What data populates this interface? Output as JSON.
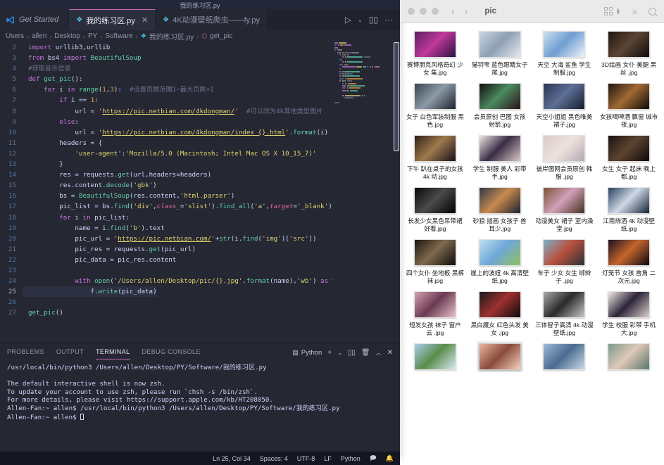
{
  "window": {
    "title": "我的练习区.py"
  },
  "editor_tabs": {
    "get_started": "Get Started",
    "tabs": [
      {
        "label": "我的练习区.py",
        "active": true,
        "close": "✕"
      },
      {
        "label": "4K动漫壁纸爬虫——fy.py",
        "active": false,
        "close": ""
      }
    ],
    "actions": [
      "run-icon",
      "chevron-down-icon",
      "split-editor-icon",
      "more-actions-icon"
    ]
  },
  "breadcrumb": {
    "items": [
      "Users",
      "allen",
      "Desktop",
      "PY",
      "Software",
      "我的练习区.py",
      "get_pic"
    ],
    "separator": "›"
  },
  "code": {
    "lines": [
      {
        "n": "2",
        "text": "import urllib3,urllib"
      },
      {
        "n": "3",
        "text": "from bs4 import BeautifulSoup"
      },
      {
        "n": "4",
        "text": "#获取音乐信息"
      },
      {
        "n": "5",
        "text": "def get_pic():"
      },
      {
        "n": "6",
        "text": "    for i in range(1,3):  #设置页数范围1~最大页数+1"
      },
      {
        "n": "7",
        "text": "        if i == 1:"
      },
      {
        "n": "8",
        "text": "            url = 'https://pic.netbian.com/4kdongman/'  #可以改为4k其他类型图片"
      },
      {
        "n": "9",
        "text": "        else:"
      },
      {
        "n": "10",
        "text": "            url = 'https://pic.netbian.com/4kdongman/index_{}.html'.format(i)"
      },
      {
        "n": "11",
        "text": "        headers = {"
      },
      {
        "n": "12",
        "text": "            'user-agent':'Mozilla/5.0 (Macintosh; Intel Mac OS X 10_15_7)'"
      },
      {
        "n": "13",
        "text": "        }"
      },
      {
        "n": "14",
        "text": "        res = requests.get(url,headers=headers)"
      },
      {
        "n": "15",
        "text": "        res.content.decode('gbk')"
      },
      {
        "n": "16",
        "text": "        bs = BeautifulSoup(res.content,'html.parser')"
      },
      {
        "n": "17",
        "text": "        pic_list = bs.find('div',class_='slist').find_all('a',target='_blank')"
      },
      {
        "n": "18",
        "text": "        for i in pic_list:"
      },
      {
        "n": "19",
        "text": "            name = i.find('b').text"
      },
      {
        "n": "20",
        "text": "            pic_url = 'https://pic.netbian.com/'+str(i.find('img')['src'])"
      },
      {
        "n": "21",
        "text": "            pic_res = requests.get(pic_url)"
      },
      {
        "n": "22",
        "text": "            pic_data = pic_res.content"
      },
      {
        "n": "23",
        "text": ""
      },
      {
        "n": "24",
        "text": "            with open('/Users/allen/Desktop/pic/{}.jpg'.format(name),'wb') as f:"
      },
      {
        "n": "25",
        "text": "                f.write(pic_data)"
      },
      {
        "n": "26",
        "text": ""
      },
      {
        "n": "27",
        "text": "get_pic()"
      }
    ],
    "cursor_line": "25"
  },
  "panel": {
    "tabs": [
      {
        "label": "PROBLEMS",
        "active": false
      },
      {
        "label": "OUTPUT",
        "active": false
      },
      {
        "label": "TERMINAL",
        "active": true
      },
      {
        "label": "DEBUG CONSOLE",
        "active": false
      }
    ],
    "shell": "Python",
    "actions": [
      "add-terminal-icon",
      "chevron-down-icon",
      "split-terminal-icon",
      "kill-terminal-icon",
      "maximize-panel-icon",
      "close-panel-icon"
    ],
    "terminal_lines": [
      "/usr/local/bin/python3 /Users/allen/Desktop/PY/Software/我的练习区.py",
      "",
      "The default interactive shell is now zsh.",
      "To update your account to use zsh, please run `chsh -s /bin/zsh`.",
      "For more details, please visit https://support.apple.com/kb/HT208050.",
      "Allen-Fan:~ allen$ /usr/local/bin/python3 /Users/allen/Desktop/PY/Software/我的练习区.py",
      "Allen-Fan:~ allen$ "
    ]
  },
  "statusbar": {
    "cursor_position": "Ln 25, Col 34",
    "indentation": "Spaces: 4",
    "encoding": "UTF-8",
    "eol": "LF",
    "language": "Python",
    "icons": [
      "feedback-icon",
      "bell-icon"
    ]
  },
  "finder": {
    "title": "pic",
    "traffic_lights": [
      "close-button",
      "minimize-button",
      "zoom-button"
    ],
    "nav": {
      "back": "‹",
      "forward": "›"
    },
    "toolbar_icons": [
      "grid-view-icon",
      "view-stepper-icon",
      "more-toolbar-icon",
      "search-icon"
    ],
    "files": [
      {
        "name": "赛博朋克风格奇幻 少女 集.jpg",
        "c1": "#5b1f63",
        "c2": "#c0389a",
        "c3": "#2a1140",
        "sel": false
      },
      {
        "name": "猫羽雫 蓝色眼睛女子 尾.jpg",
        "c1": "#c8d6e2",
        "c2": "#8e9fb4",
        "c3": "#e5e9ee",
        "sel": false
      },
      {
        "name": "天空 大海 鲨鱼 学生制服.jpg",
        "c1": "#cfe0ef",
        "c2": "#6f9ed0",
        "c3": "#eef4fa",
        "sel": false
      },
      {
        "name": "3D绘画 女仆 美腿 黑丝 .jpg",
        "c1": "#20150f",
        "c2": "#5b4535",
        "c3": "#100b08",
        "sel": false
      },
      {
        "name": "女子 白色军装制服 黑色.jpg",
        "c1": "#3a4450",
        "c2": "#8c9aa8",
        "c3": "#1d242c",
        "sel": false
      },
      {
        "name": "会员原创 巴图 女孩 射箭.jpg",
        "c1": "#140d10",
        "c2": "#4b8a5e",
        "c3": "#2a1218",
        "sel": false
      },
      {
        "name": "天空小姐姐 黑色唯美裙子.jpg",
        "c1": "#2b3550",
        "c2": "#5d6f96",
        "c3": "#161c2c",
        "sel": false
      },
      {
        "name": "女孩喝啤酒 飘窗 城市夜.jpg",
        "c1": "#201512",
        "c2": "#a06a33",
        "c3": "#0f0a09",
        "sel": false
      },
      {
        "name": "下午 趴在桌子的女孩 4k 动.jpg",
        "c1": "#2e2016",
        "c2": "#9e7a4d",
        "c3": "#141015",
        "sel": false
      },
      {
        "name": "学生 制服 美人 彩带 手.jpg",
        "c1": "#efe7e4",
        "c2": "#3a2c46",
        "c3": "#d9c9c4",
        "sel": false
      },
      {
        "name": "彼岸图网会员原创 韩服 .jpg",
        "c1": "#d8c9c5",
        "c2": "#efe3de",
        "c3": "#b4a8b4",
        "sel": false
      },
      {
        "name": "女生 女子 起床 晚上 都.jpg",
        "c1": "#1a120f",
        "c2": "#5d4330",
        "c3": "#0c0807",
        "sel": false
      },
      {
        "name": "长发少女黑色吊带裙 好看.jpg",
        "c1": "#0a0a0a",
        "c2": "#4a4a4a",
        "c3": "#000000",
        "sel": false
      },
      {
        "name": "砂狼 插画 女孩子 兽耳少.jpg",
        "c1": "#2f3948",
        "c2": "#c88a4e",
        "c3": "#1a2230",
        "sel": false
      },
      {
        "name": "动漫美女 裙子 室内澡堂.jpg",
        "c1": "#7a5436",
        "c2": "#d2a0b8",
        "c3": "#43301f",
        "sel": false
      },
      {
        "name": "江南烧酒 4k 动漫壁纸.jpg",
        "c1": "#26405e",
        "c2": "#cfd9e6",
        "c3": "#132238",
        "sel": false
      },
      {
        "name": "四个女仆 坐地板 黑裤袜.jpg",
        "c1": "#1c1610",
        "c2": "#7e6a4e",
        "c3": "#0d0a07",
        "sel": false
      },
      {
        "name": "崖上的波妞 4k 高清壁纸.jpg",
        "c1": "#bfe0f2",
        "c2": "#6ea8d8",
        "c3": "#8fbf5e",
        "sel": false
      },
      {
        "name": "车子 少女 女生 绑辫子 .jpg",
        "c1": "#7fb2c8",
        "c2": "#b8503c",
        "c3": "#2a3238",
        "sel": false
      },
      {
        "name": "灯笼节 女孩 兽角 二次元.jpg",
        "c1": "#1a1020",
        "c2": "#c4662c",
        "c3": "#0d0712",
        "sel": false
      },
      {
        "name": "短发女孩 袜子 窗户 云 .jpg",
        "c1": "#d8a0b0",
        "c2": "#6a3a52",
        "c3": "#e8c2cc",
        "sel": false
      },
      {
        "name": "黑白魔女 红色头发 美女 .jpg",
        "c1": "#1a1a1c",
        "c2": "#9e3030",
        "c3": "#0c0c0e",
        "sel": false
      },
      {
        "name": "三体智子高清 4k 动漫壁纸.jpg",
        "c1": "#a8a8a8",
        "c2": "#2a2a2c",
        "c3": "#c8c8c8",
        "sel": false
      },
      {
        "name": "学生 校服 彩带 手机 大.jpg",
        "c1": "#f0ebe6",
        "c2": "#2c2438",
        "c3": "#dcd2cc",
        "sel": false
      },
      {
        "name": "",
        "c1": "#a8cfe8",
        "c2": "#5a8c4a",
        "c3": "#d8ecf4",
        "sel": false
      },
      {
        "name": "",
        "c1": "#e8b89c",
        "c2": "#8a4a3c",
        "c3": "#f2d2bc",
        "sel": true
      },
      {
        "name": "",
        "c1": "#9dbcd8",
        "c2": "#4a6a90",
        "c3": "#c8dce8",
        "sel": false
      },
      {
        "name": "",
        "c1": "#7a9a8c",
        "c2": "#e0c8b8",
        "c3": "#56786a",
        "sel": false
      }
    ]
  }
}
